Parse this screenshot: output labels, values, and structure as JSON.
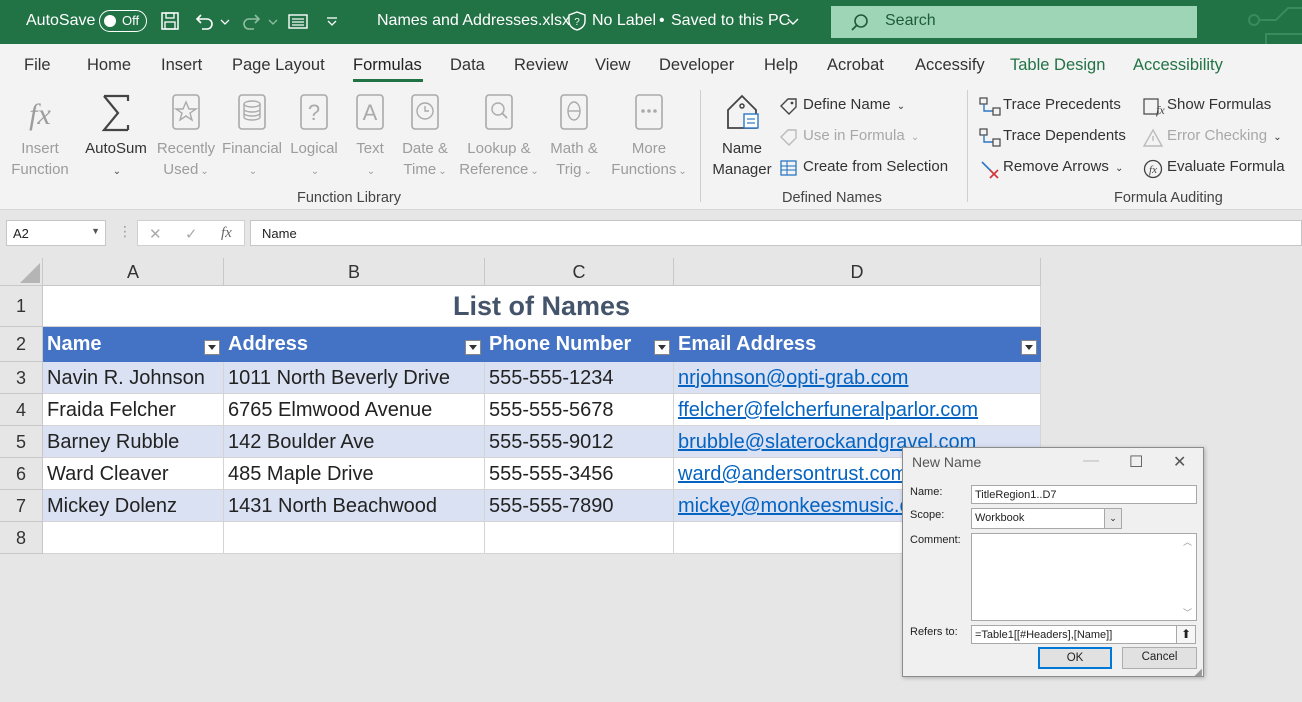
{
  "titlebar": {
    "autosave_label": "AutoSave",
    "autosave_state": "Off",
    "filename": "Names and Addresses.xlsx",
    "sensitivity": "No Label",
    "save_status": "Saved to this PC",
    "separator": "•",
    "search_placeholder": "Search"
  },
  "tabs": [
    "File",
    "Home",
    "Insert",
    "Page Layout",
    "Formulas",
    "Data",
    "Review",
    "View",
    "Developer",
    "Help",
    "Acrobat",
    "Accessify",
    "Table Design",
    "Accessibility"
  ],
  "ribbon": {
    "function_library": {
      "group_label": "Function Library",
      "insert_function": [
        "Insert",
        "Function"
      ],
      "autosum": "AutoSum",
      "recently_used": [
        "Recently",
        "Used"
      ],
      "financial": "Financial",
      "logical": "Logical",
      "text": "Text",
      "date_time": [
        "Date &",
        "Time"
      ],
      "lookup_reference": [
        "Lookup &",
        "Reference"
      ],
      "math_trig": [
        "Math &",
        "Trig"
      ],
      "more_functions": [
        "More",
        "Functions"
      ]
    },
    "defined_names": {
      "group_label": "Defined Names",
      "name_manager": [
        "Name",
        "Manager"
      ],
      "define_name": "Define Name",
      "use_in_formula": "Use in Formula",
      "create_from_selection": "Create from Selection"
    },
    "formula_auditing": {
      "group_label": "Formula Auditing",
      "trace_precedents": "Trace Precedents",
      "trace_dependents": "Trace Dependents",
      "remove_arrows": "Remove Arrows",
      "show_formulas": "Show Formulas",
      "error_checking": "Error Checking",
      "evaluate_formula": "Evaluate Formula"
    }
  },
  "formula_bar": {
    "name_box": "A2",
    "cancel": "✕",
    "enter": "✓",
    "fx": "fx",
    "value": "Name"
  },
  "sheet": {
    "columns": [
      "A",
      "B",
      "C",
      "D"
    ],
    "rows": [
      "1",
      "2",
      "3",
      "4",
      "5",
      "6",
      "7",
      "8"
    ],
    "title": "List of Names",
    "headers": [
      "Name",
      "Address",
      "Phone Number",
      "Email Address"
    ],
    "data": [
      [
        "Navin R. Johnson",
        "1011 North Beverly Drive",
        "555-555-1234",
        "nrjohnson@opti-grab.com"
      ],
      [
        "Fraida Felcher",
        "6765 Elmwood Avenue",
        "555-555-5678",
        "ffelcher@felcherfuneralparlor.com"
      ],
      [
        "Barney Rubble",
        "142 Boulder Ave",
        "555-555-9012",
        "brubble@slaterockandgravel.com"
      ],
      [
        "Ward Cleaver",
        "485 Maple Drive",
        "555-555-3456",
        "ward@andersontrust.com"
      ],
      [
        "Mickey Dolenz",
        "1431 North Beachwood",
        "555-555-7890",
        "mickey@monkeesmusic.com"
      ]
    ]
  },
  "dialog": {
    "title": "New Name",
    "name_label": "Name:",
    "name_value": "TitleRegion1..D7",
    "scope_label": "Scope:",
    "scope_value": "Workbook",
    "comment_label": "Comment:",
    "comment_value": "",
    "refers_label": "Refers to:",
    "refers_value": "=Table1[[#Headers],[Name]]",
    "ok": "OK",
    "cancel": "Cancel"
  },
  "colors": {
    "excel_green": "#217346",
    "table_header": "#4472c4",
    "band": "#d9e1f2",
    "link": "#0563c1",
    "title": "#44546a"
  }
}
